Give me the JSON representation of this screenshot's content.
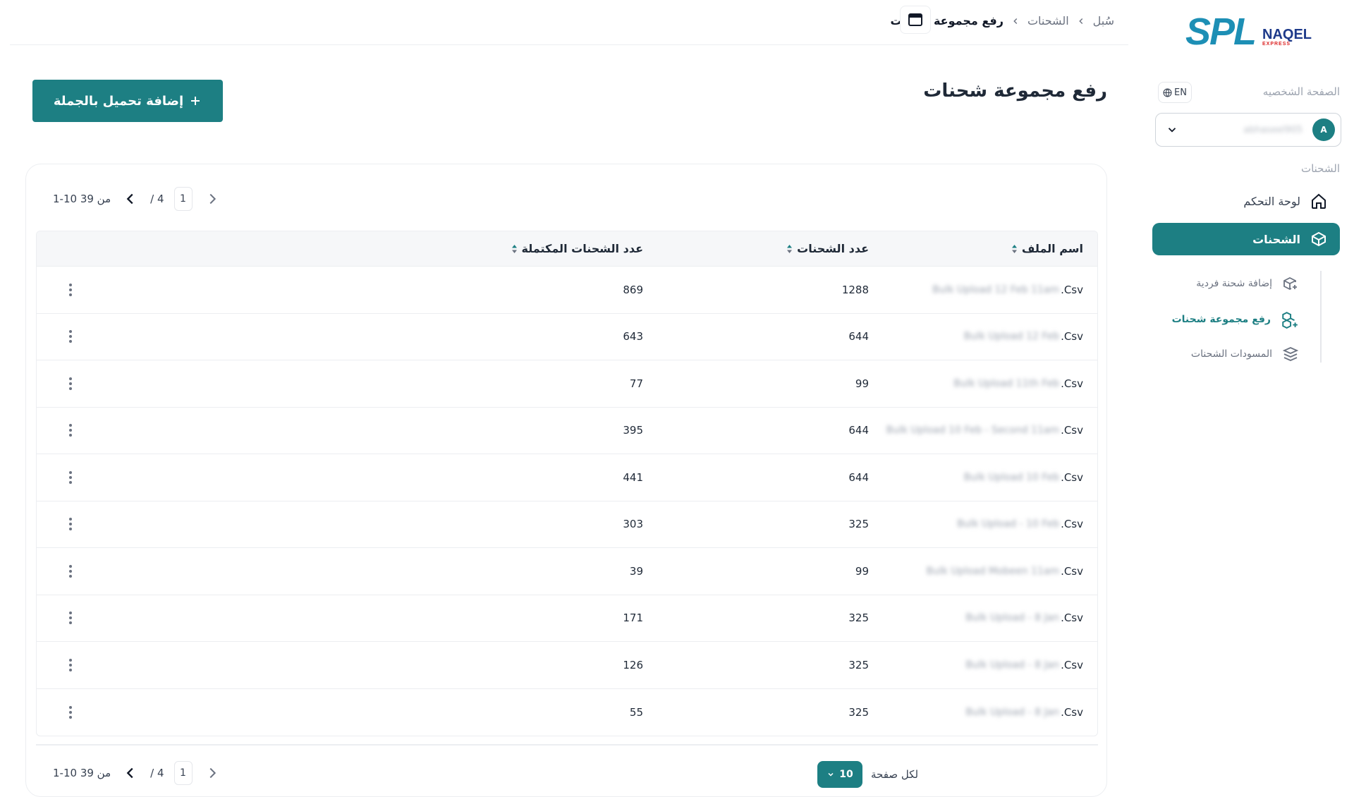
{
  "brand": {
    "logo_main": "SPL",
    "logo_arabic": "سبل",
    "logo_secondary": "NAQEL",
    "logo_secondary_sub": "EXPRESS"
  },
  "topbar": {
    "breadcrumbs": [
      {
        "label": "سُبل"
      },
      {
        "label": "الشحنات"
      },
      {
        "label": "رفع مجموعة شحنات"
      }
    ]
  },
  "sidebar": {
    "profile_label": "الصفحة الشخصيه",
    "language_label": "EN",
    "user": {
      "initial": "A",
      "name": "abhaseel905"
    },
    "section_label": "الشحنات",
    "items": [
      {
        "label": "لوحة التحكم",
        "icon": "home-icon"
      },
      {
        "label": "الشحنات",
        "icon": "package-icon",
        "active": true
      }
    ],
    "subitems": [
      {
        "label": "إضافة شحنة فردية",
        "icon": "package-plus-icon"
      },
      {
        "label": "رفع مجموعة شحنات",
        "icon": "packages-plus-icon",
        "active": true
      },
      {
        "label": "المسودات الشحنات",
        "icon": "package-stack-icon"
      }
    ]
  },
  "main": {
    "title": "رفع مجموعة شحنات",
    "add_button_label": "إضافة تحميل بالجملة",
    "pagination": {
      "range_text": "1-10 من 39",
      "current_page": "1",
      "total_pages_text": "/ 4"
    },
    "table": {
      "headers": {
        "name": "اسم الملف",
        "count": "عدد الشحنات",
        "completed": "عدد الشحنات المكتملة"
      },
      "rows": [
        {
          "name": "Bulk Upload 12 Feb 11am",
          "ext": ".Csv",
          "count": "1288",
          "completed": "869"
        },
        {
          "name": "Bulk Upload 12 Feb",
          "ext": ".Csv",
          "count": "644",
          "completed": "643"
        },
        {
          "name": "Bulk Upload 11th Feb",
          "ext": ".Csv",
          "count": "99",
          "completed": "77"
        },
        {
          "name": "Bulk Upload 10 Feb - Second 11am",
          "ext": ".Csv",
          "count": "644",
          "completed": "395"
        },
        {
          "name": "Bulk Upload 10 Feb",
          "ext": ".Csv",
          "count": "644",
          "completed": "441"
        },
        {
          "name": "Bulk Upload - 10 Feb",
          "ext": ".Csv",
          "count": "325",
          "completed": "303"
        },
        {
          "name": "Bulk Upload Mobeen 11am",
          "ext": ".Csv",
          "count": "99",
          "completed": "39"
        },
        {
          "name": "Bulk Upload - 8 Jan",
          "ext": ".Csv",
          "count": "325",
          "completed": "171"
        },
        {
          "name": "Bulk Upload - 8 Jan",
          "ext": ".Csv",
          "count": "325",
          "completed": "126"
        },
        {
          "name": "Bulk Upload - 8 Jan",
          "ext": ".Csv",
          "count": "325",
          "completed": "55"
        }
      ]
    },
    "per_page": {
      "label": "لكل صفحة",
      "value": "10"
    }
  },
  "colors": {
    "primary": "#1d7f83",
    "text": "#1f2937",
    "muted": "#9ca3af"
  }
}
